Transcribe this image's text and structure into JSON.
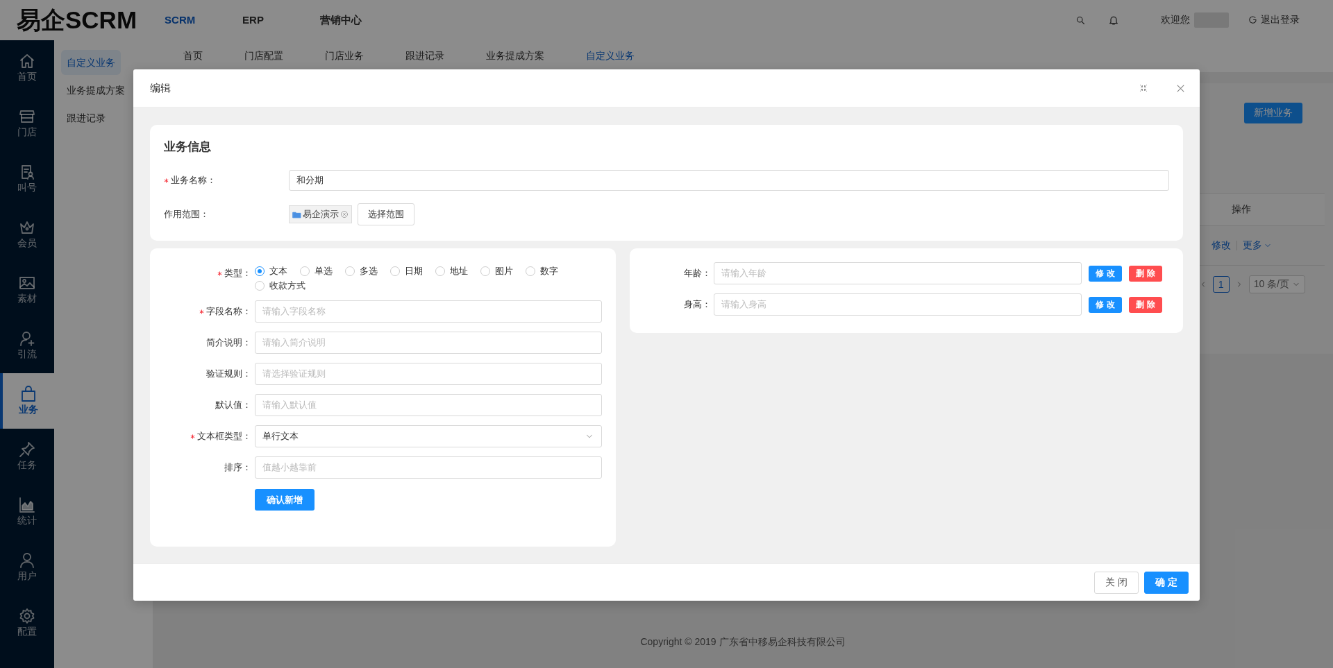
{
  "header": {
    "logo": "易企SCRM",
    "nav": [
      {
        "label": "SCRM",
        "selected": true
      },
      {
        "label": "ERP",
        "selected": false
      },
      {
        "label": "营销中心",
        "selected": false
      }
    ],
    "welcome": "欢迎您",
    "logout": "退出登录"
  },
  "sidebar": {
    "items": [
      {
        "label": "首页",
        "selected": false
      },
      {
        "label": "门店",
        "selected": false
      },
      {
        "label": "叫号",
        "selected": false
      },
      {
        "label": "会员",
        "selected": false
      },
      {
        "label": "素材",
        "selected": false
      },
      {
        "label": "引流",
        "selected": false
      },
      {
        "label": "业务",
        "selected": true
      },
      {
        "label": "任务",
        "selected": false
      },
      {
        "label": "统计",
        "selected": false
      },
      {
        "label": "用户",
        "selected": false
      },
      {
        "label": "配置",
        "selected": false
      }
    ]
  },
  "submenu": {
    "items": [
      {
        "label": "自定义业务",
        "selected": true
      },
      {
        "label": "业务提成方案",
        "selected": false
      },
      {
        "label": "跟进记录",
        "selected": false
      }
    ]
  },
  "tabs": [
    {
      "label": "首页",
      "selected": false
    },
    {
      "label": "门店配置",
      "selected": false
    },
    {
      "label": "门店业务",
      "selected": false
    },
    {
      "label": "跟进记录",
      "selected": false
    },
    {
      "label": "业务提成方案",
      "selected": false
    },
    {
      "label": "自定义业务",
      "selected": true
    }
  ],
  "page": {
    "add_button": "新增业务",
    "table_header": "操作",
    "row_actions": [
      "修改",
      "更多"
    ],
    "pagination": {
      "page": "1",
      "page_size": "10 条/页"
    }
  },
  "footer": "Copyright © 2019 广东省中移易企科技有限公司",
  "dialog": {
    "title": "编辑",
    "info": {
      "title": "业务信息",
      "name_label": "业务名称：",
      "name_required": true,
      "name_value": "和分期",
      "scope_label": "作用范围：",
      "scope_tags": [
        "易企演示"
      ],
      "scope_button": "选择范围"
    },
    "field_form": {
      "fields": [
        {
          "kind": "radio",
          "label": "类型：",
          "required": true,
          "options": [
            {
              "label": "文本",
              "selected": true
            },
            {
              "label": "单选",
              "selected": false
            },
            {
              "label": "多选",
              "selected": false
            },
            {
              "label": "日期",
              "selected": false
            },
            {
              "label": "地址",
              "selected": false
            },
            {
              "label": "图片",
              "selected": false
            },
            {
              "label": "数字",
              "selected": false
            },
            {
              "label": "收款方式",
              "selected": false
            }
          ]
        },
        {
          "kind": "input",
          "label": "字段名称：",
          "required": true,
          "placeholder": "请输入字段名称"
        },
        {
          "kind": "input",
          "label": "简介说明：",
          "required": false,
          "placeholder": "请输入简介说明"
        },
        {
          "kind": "input",
          "label": "验证规则：",
          "required": false,
          "placeholder": "请选择验证规则"
        },
        {
          "kind": "input",
          "label": "默认值：",
          "required": false,
          "placeholder": "请输入默认值"
        },
        {
          "kind": "select",
          "label": "文本框类型：",
          "required": true,
          "value": "单行文本"
        },
        {
          "kind": "input",
          "label": "排序：",
          "required": false,
          "placeholder": "值越小越靠前"
        }
      ],
      "submit": "确认新增"
    },
    "custom_fields": [
      {
        "label": "年龄：",
        "placeholder": "请输入年龄",
        "edit": "修 改",
        "delete": "删 除"
      },
      {
        "label": "身高：",
        "placeholder": "请输入身高",
        "edit": "修 改",
        "delete": "删 除"
      }
    ],
    "buttons": [
      {
        "label": "关 闭",
        "kind": "default"
      },
      {
        "label": "确 定",
        "kind": "primary"
      }
    ]
  }
}
